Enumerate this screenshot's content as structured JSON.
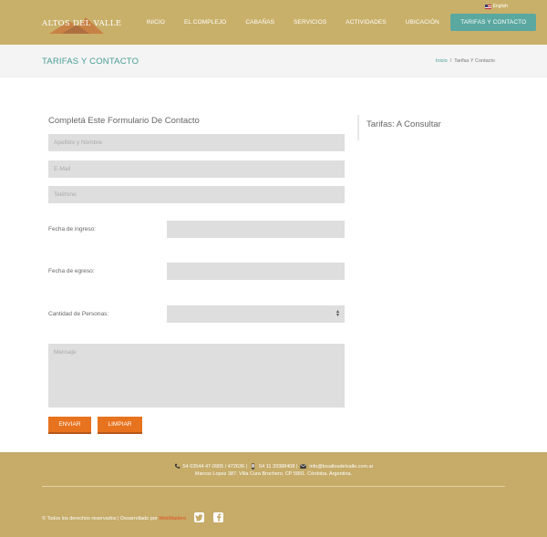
{
  "header": {
    "language": "English",
    "logo_text": "ALTOS DEL VALLE",
    "nav": [
      "INICIO",
      "EL COMPLEJO",
      "CABAÑAS",
      "SERVICIOS",
      "ACTIVIDADES",
      "UBICACIÓN",
      "TARIFAS Y CONTACTO"
    ]
  },
  "titlebar": {
    "title": "TARIFAS Y CONTACTO",
    "breadcrumb_home": "Inicio",
    "breadcrumb_sep": "/",
    "breadcrumb_current": "Tarifas Y Contacto"
  },
  "form": {
    "title": "Completá Este Formulario De Contacto",
    "name_placeholder": "Apellido y Nombre",
    "email_placeholder": "E-Mail",
    "phone_placeholder": "Teléfono",
    "checkin_label": "Fecha de ingreso:",
    "checkout_label": "Fecha de egreso:",
    "people_label": "Cantidad de Personas:",
    "message_placeholder": "Mensaje",
    "send_label": "ENVIAR",
    "clear_label": "LIMPIAR"
  },
  "sidebar": {
    "title": "Tarifas: A Consultar"
  },
  "footer": {
    "phone": "54 03544 47-0905 / 472636 |",
    "mobile": "54 11 33388408 |",
    "email": "info@losaltosdelvalle.com.ar",
    "address": "Marcos Lopez 387. Villa Cura Brochero. CP 5891. Córdoba. Argentina.",
    "copyright": "© Todos los derechos reservados | Desarrollado por",
    "developer": "WebMadero"
  },
  "colors": {
    "header_bg": "#c9b06a",
    "accent_teal": "#5aa8a0",
    "button_orange": "#e8731e",
    "footer_bg": "#c6ab69"
  },
  "icons": [
    "flag-us-icon",
    "phone-icon",
    "mobile-icon",
    "email-icon",
    "twitter-icon",
    "facebook-icon",
    "select-arrows-icon"
  ]
}
